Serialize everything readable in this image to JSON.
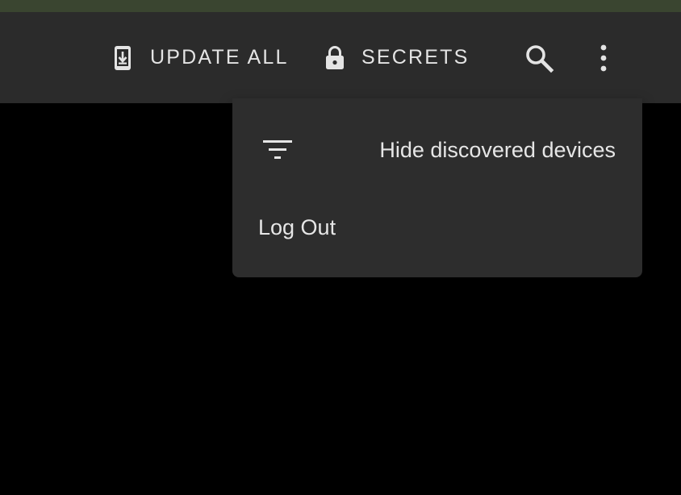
{
  "colors": {
    "top_strip": "#3a4530",
    "toolbar_bg": "#2b2b2b",
    "menu_bg": "#2d2d2d",
    "content_bg": "#000000",
    "text": "#e6e6e6"
  },
  "toolbar": {
    "update_all": {
      "label": "UPDATE ALL",
      "icon": "cellphone-arrow-down-icon"
    },
    "secrets": {
      "label": "SECRETS",
      "icon": "lock-icon"
    },
    "search": {
      "icon": "search-icon"
    },
    "more": {
      "icon": "more-vertical-icon"
    }
  },
  "menu": {
    "items": [
      {
        "label": "Hide discovered devices",
        "icon": "filter-icon"
      },
      {
        "label": "Log Out"
      }
    ]
  }
}
